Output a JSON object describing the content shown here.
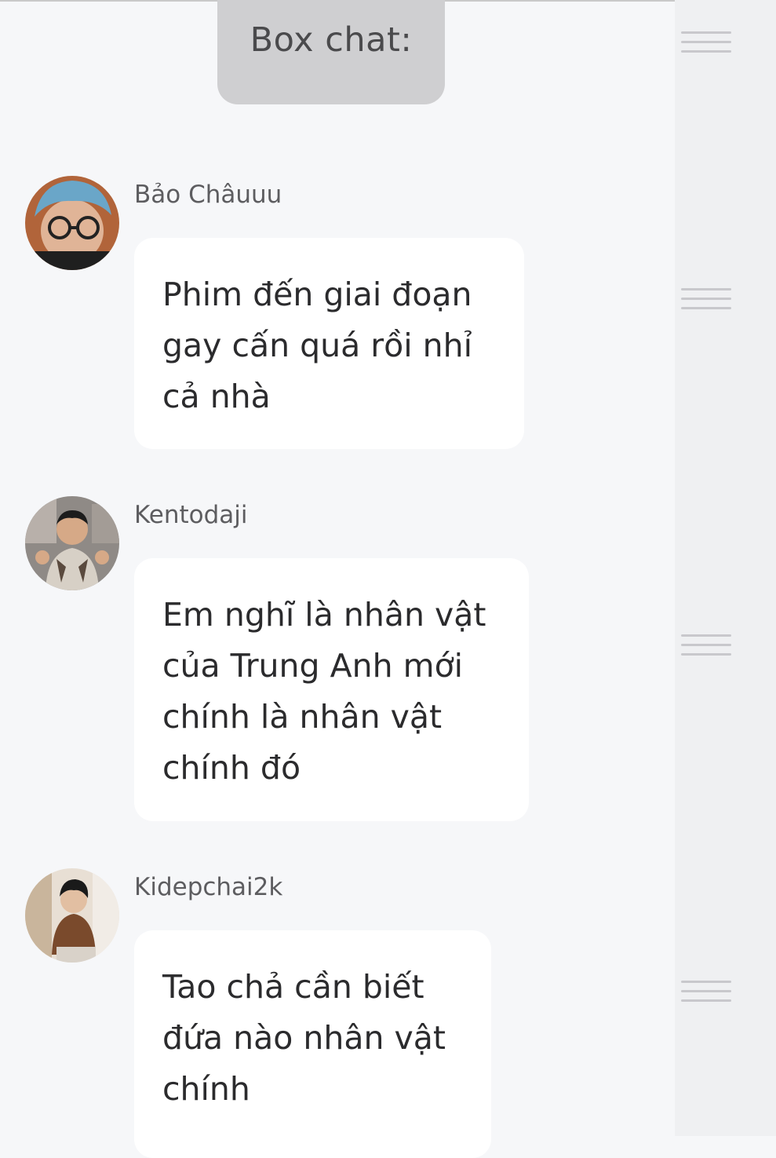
{
  "header": {
    "title": "Box chat:"
  },
  "messages": [
    {
      "name": "Bảo Châuuu",
      "lines": [
        "Phim đến giai đoạn",
        "gay cấn quá rồi nhỉ",
        "cả nhà"
      ]
    },
    {
      "name": "Kentodaji",
      "lines": [
        "Em nghĩ là nhân vật",
        "của Trung Anh mới",
        "chính là nhân vật",
        "chính đó"
      ]
    },
    {
      "name": "Kidepchai2k",
      "lines": [
        "Tao chả cần biết",
        "đứa nào nhân vật",
        "chính"
      ]
    }
  ],
  "icons": {
    "reorder": "drag-handle-icon",
    "avatar": "avatar"
  },
  "colors": {
    "background": "#f6f7f9",
    "rail": "#eff0f2",
    "title_chip": "#cfcfd1",
    "bubble": "#ffffff",
    "handle": "#c8c8cc"
  }
}
